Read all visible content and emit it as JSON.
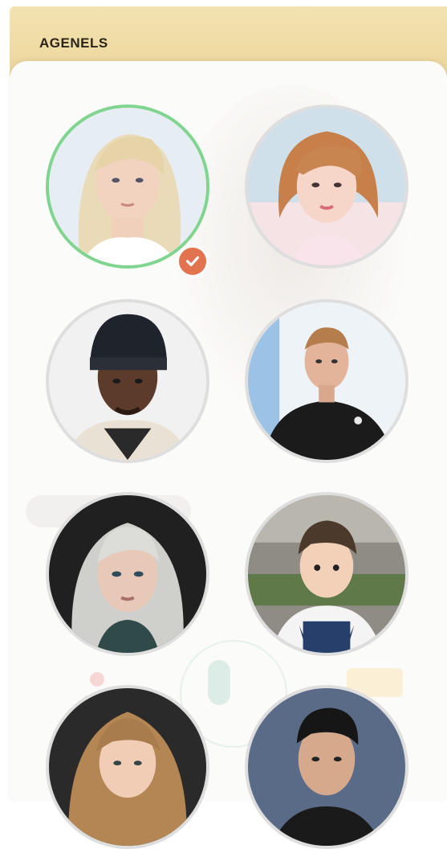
{
  "header": {
    "title": "AGENELS"
  },
  "avatars": [
    {
      "id": "blonde-woman",
      "selected": true
    },
    {
      "id": "auburn-hair-woman",
      "selected": false
    },
    {
      "id": "man-black-beanie",
      "selected": false
    },
    {
      "id": "man-black-tshirt",
      "selected": false
    },
    {
      "id": "silver-hair-woman",
      "selected": false
    },
    {
      "id": "toddler-overalls",
      "selected": false
    },
    {
      "id": "curly-hair-girl",
      "selected": false
    },
    {
      "id": "dark-hair-man",
      "selected": false
    }
  ],
  "icons": {
    "selected_badge": "check-icon"
  },
  "colors": {
    "header_bg": "#efdba3",
    "selected_ring": "#7fd58f",
    "badge": "#e2734f"
  }
}
